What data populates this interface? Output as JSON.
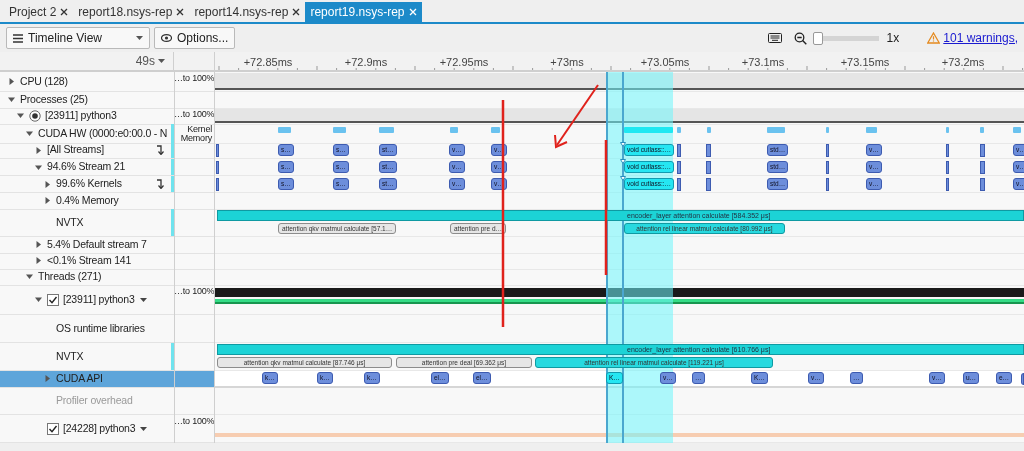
{
  "tabs": [
    {
      "label": "Project 2",
      "selected": false
    },
    {
      "label": "report18.nsys-rep",
      "selected": false
    },
    {
      "label": "report14.nsys-rep",
      "selected": false
    },
    {
      "label": "report19.nsys-rep",
      "selected": true
    }
  ],
  "toolbar": {
    "view_menu": "Timeline View",
    "options_button": "Options...",
    "zoom": {
      "level": 0,
      "reading": "1x"
    },
    "warnings_link": "101 warnings,"
  },
  "header": {
    "time_range": "49s",
    "ticks": [
      "+72.85ms",
      "+72.9ms",
      "+72.95ms",
      "+73ms",
      "+73.05ms",
      "+73.1ms",
      "+73.15ms",
      "+73.2ms"
    ]
  },
  "rows": [
    {
      "kind": "cpu",
      "label": "CPU (128)",
      "expanded": false,
      "selected": false,
      "disabled": false,
      "accent": false,
      "stack_toggle": false,
      "scale": "…to 100%"
    },
    {
      "kind": "empty",
      "label": "Processes (25)",
      "expanded": true,
      "selected": false,
      "disabled": false,
      "accent": false,
      "stack_toggle": false,
      "children": [
        {
          "kind": "process",
          "label": "[23911] python3",
          "expanded": true,
          "selected": false,
          "disabled": false,
          "accent": false,
          "stack_toggle": false,
          "scale": "…to 100%",
          "children": [
            {
              "kind": "hw",
              "label": "CUDA HW (0000:e0:00.0 - N",
              "expanded": true,
              "selected": false,
              "disabled": false,
              "accent": true,
              "stack_toggle": false,
              "legend": [
                "Kernel",
                "Memory"
              ],
              "children": [
                {
                  "kind": "streams",
                  "label": "[All Streams]",
                  "expanded": false,
                  "selected": false,
                  "disabled": false,
                  "accent": true,
                  "stack_toggle": true,
                  "events": [
                    {
                      "label": "s…",
                      "selected": false
                    },
                    {
                      "label": "s…",
                      "selected": false
                    },
                    {
                      "label": "st…",
                      "selected": false
                    },
                    {
                      "label": "v…",
                      "selected": false
                    },
                    {
                      "label": "v…",
                      "selected": false
                    },
                    {
                      "label": "void cutlass::…",
                      "selected": true
                    },
                    {
                      "label": "std…",
                      "selected": false
                    },
                    {
                      "label": "v…",
                      "selected": false
                    },
                    {
                      "label": "v…",
                      "selected": false
                    }
                  ]
                },
                {
                  "kind": "streams",
                  "label": "94.6% Stream 21",
                  "expanded": true,
                  "selected": false,
                  "disabled": false,
                  "accent": true,
                  "stack_toggle": false,
                  "events": [
                    {
                      "label": "s…",
                      "selected": false
                    },
                    {
                      "label": "s…",
                      "selected": false
                    },
                    {
                      "label": "st…",
                      "selected": false
                    },
                    {
                      "label": "v…",
                      "selected": false
                    },
                    {
                      "label": "v…",
                      "selected": false
                    },
                    {
                      "label": "void cutlass::…",
                      "selected": true
                    },
                    {
                      "label": "std…",
                      "selected": false
                    },
                    {
                      "label": "v…",
                      "selected": false
                    },
                    {
                      "label": "v…",
                      "selected": false
                    }
                  ],
                  "children": [
                    {
                      "kind": "streams",
                      "label": "99.6% Kernels",
                      "expanded": false,
                      "selected": false,
                      "disabled": false,
                      "accent": true,
                      "stack_toggle": true,
                      "events": [
                        {
                          "label": "s…",
                          "selected": false
                        },
                        {
                          "label": "s…",
                          "selected": false
                        },
                        {
                          "label": "st…",
                          "selected": false
                        },
                        {
                          "label": "v…",
                          "selected": false
                        },
                        {
                          "label": "v…",
                          "selected": false
                        },
                        {
                          "label": "void cutlass::…",
                          "selected": true
                        },
                        {
                          "label": "std…",
                          "selected": false
                        },
                        {
                          "label": "v…",
                          "selected": false
                        },
                        {
                          "label": "v…",
                          "selected": false
                        }
                      ]
                    },
                    {
                      "kind": "empty",
                      "label": "0.4% Memory",
                      "expanded": false,
                      "selected": false,
                      "disabled": false,
                      "accent": false,
                      "stack_toggle": false
                    },
                    {
                      "kind": "nvtx",
                      "label": "NVTX",
                      "selected": false,
                      "disabled": false,
                      "accent": true,
                      "stack_toggle": false,
                      "range": "encoder_layer attention calculate [584.352 μs]",
                      "events": [
                        {
                          "label": "attention qkv matmul calculate [57.1…",
                          "selected": false
                        },
                        {
                          "label": "attention pre d…",
                          "selected": false
                        },
                        {
                          "label": "attention rel linear matmul calculate [80.992 μs]",
                          "selected": true
                        }
                      ]
                    }
                  ]
                },
                {
                  "kind": "empty",
                  "label": "5.4% Default stream 7",
                  "expanded": false,
                  "selected": false,
                  "disabled": false,
                  "accent": false,
                  "stack_toggle": false
                },
                {
                  "kind": "empty",
                  "label": "<0.1% Stream 141",
                  "expanded": false,
                  "selected": false,
                  "disabled": false,
                  "accent": false,
                  "stack_toggle": false
                }
              ]
            },
            {
              "kind": "empty",
              "label": "Threads (271)",
              "expanded": true,
              "selected": false,
              "disabled": false,
              "accent": false,
              "stack_toggle": false,
              "children": [
                {
                  "kind": "thread_busy",
                  "label": "[23911] python3",
                  "expanded": true,
                  "checked": true,
                  "selected": false,
                  "disabled": false,
                  "accent": false,
                  "stack_toggle": false,
                  "scale": "…to 100%",
                  "children": [
                    {
                      "kind": "empty_tall",
                      "label": "OS runtime libraries",
                      "selected": false,
                      "disabled": false,
                      "accent": false,
                      "stack_toggle": false
                    },
                    {
                      "kind": "nvtx",
                      "label": "NVTX",
                      "selected": false,
                      "disabled": false,
                      "accent": true,
                      "stack_toggle": false,
                      "range": "encoder_layer attention calculate [610.766 μs]",
                      "events": [
                        {
                          "label": "attention qkv matmul calculate [87.746 μs]",
                          "selected": false
                        },
                        {
                          "label": "attention pre deal [69.362 μs]",
                          "selected": false
                        },
                        {
                          "label": "attention rel linear matmul calculate [119.221 μs]",
                          "selected": true
                        }
                      ]
                    },
                    {
                      "kind": "api",
                      "label": "CUDA API",
                      "expanded": false,
                      "selected": true,
                      "disabled": false,
                      "accent": false,
                      "stack_toggle": false,
                      "events": [
                        {
                          "label": "k…",
                          "selected": false
                        },
                        {
                          "label": "k…",
                          "selected": false
                        },
                        {
                          "label": "k…",
                          "selected": false
                        },
                        {
                          "label": "el…",
                          "selected": false
                        },
                        {
                          "label": "el…",
                          "selected": false
                        },
                        {
                          "label": "K…",
                          "selected": true
                        },
                        {
                          "label": "v…",
                          "selected": false
                        },
                        {
                          "label": "…",
                          "selected": false
                        },
                        {
                          "label": "K…",
                          "selected": false
                        },
                        {
                          "label": "v…",
                          "selected": false
                        },
                        {
                          "label": "…",
                          "selected": false
                        },
                        {
                          "label": "v…",
                          "selected": false
                        },
                        {
                          "label": "u…",
                          "selected": false
                        },
                        {
                          "label": "e…",
                          "selected": false
                        }
                      ]
                    },
                    {
                      "kind": "empty_tall",
                      "label": "Profiler overhead",
                      "selected": false,
                      "disabled": true,
                      "accent": false,
                      "stack_toggle": false
                    }
                  ]
                },
                {
                  "kind": "thread_idle",
                  "label": "[24228] python3",
                  "checked": true,
                  "selected": false,
                  "disabled": false,
                  "accent": false,
                  "stack_toggle": false,
                  "scale": "…to 100%"
                }
              ]
            }
          ]
        }
      ]
    }
  ]
}
